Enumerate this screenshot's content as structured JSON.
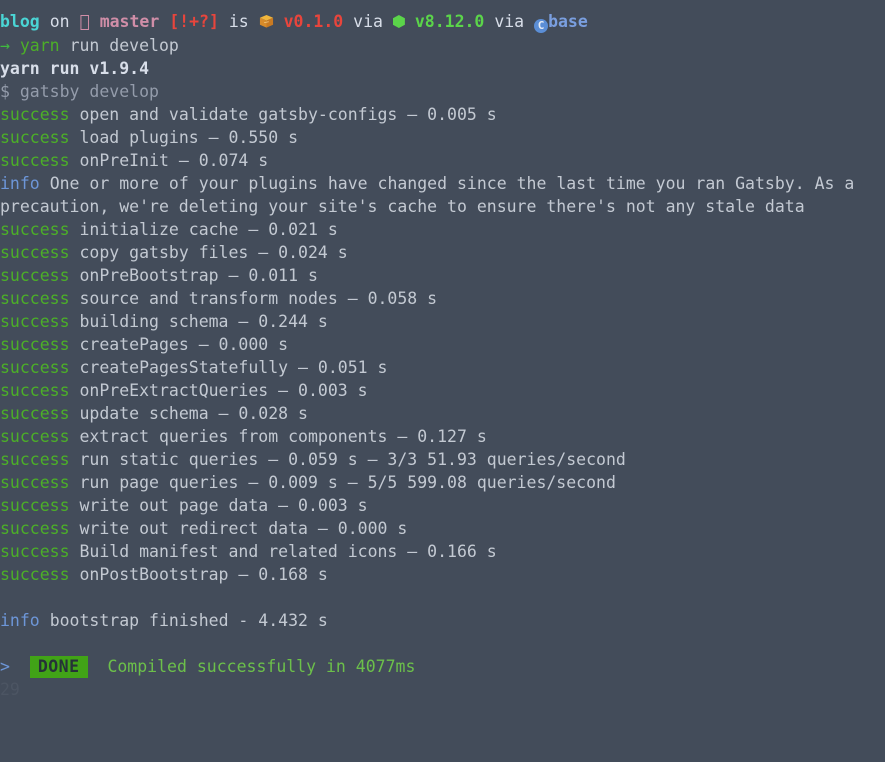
{
  "terminal": {
    "background_color": "#434c5a",
    "foreground_color": "#c9ced6",
    "prompt": {
      "dir": "blog",
      "on": "on",
      "branch_icon": "git-branch-icon",
      "branch": "master",
      "git_status": "[!+?]",
      "is": "is",
      "package_icon": "package-emoji",
      "package_version": "v0.1.0",
      "via1": "via",
      "node_icon": "node-hexagon-icon",
      "node_version": "v8.12.0",
      "via2": "via",
      "conda_icon": "conda-circle-icon",
      "conda_env": "base"
    },
    "command": {
      "arrow": "→",
      "program": "yarn",
      "args": "run develop"
    },
    "output": {
      "version_line": "yarn run v1.9.4",
      "script_line": "$ gatsby develop",
      "info_label": "info",
      "success_label": "success",
      "entries": [
        {
          "label": "success",
          "text": "open and validate gatsby-configs — 0.005 s"
        },
        {
          "label": "success",
          "text": "load plugins — 0.550 s"
        },
        {
          "label": "success",
          "text": "onPreInit — 0.074 s"
        }
      ],
      "info_message": "One or more of your plugins have changed since the last time you ran Gatsby. As a precaution, we're deleting your site's cache to ensure there's not any stale data",
      "entries2": [
        {
          "label": "success",
          "text": "initialize cache — 0.021 s"
        },
        {
          "label": "success",
          "text": "copy gatsby files — 0.024 s"
        },
        {
          "label": "success",
          "text": "onPreBootstrap — 0.011 s"
        },
        {
          "label": "success",
          "text": "source and transform nodes — 0.058 s"
        },
        {
          "label": "success",
          "text": "building schema — 0.244 s"
        },
        {
          "label": "success",
          "text": "createPages — 0.000 s"
        },
        {
          "label": "success",
          "text": "createPagesStatefully — 0.051 s"
        },
        {
          "label": "success",
          "text": "onPreExtractQueries — 0.003 s"
        },
        {
          "label": "success",
          "text": "update schema — 0.028 s"
        },
        {
          "label": "success",
          "text": "extract queries from components — 0.127 s"
        },
        {
          "label": "success",
          "text": "run static queries — 0.059 s — 3/3 51.93 queries/second"
        },
        {
          "label": "success",
          "text": "run page queries — 0.009 s — 5/5 599.08 queries/second"
        },
        {
          "label": "success",
          "text": "write out page data — 0.003 s"
        },
        {
          "label": "success",
          "text": "write out redirect data — 0.000 s"
        },
        {
          "label": "success",
          "text": "Build manifest and related icons — 0.166 s"
        },
        {
          "label": "success",
          "text": "onPostBootstrap — 0.168 s"
        }
      ],
      "bootstrap_label": "info",
      "bootstrap_text": "bootstrap finished - 4.432 s",
      "compile_chevron": ">",
      "compile_badge": "DONE",
      "compile_text": "Compiled successfully in 4077ms",
      "trailing_number": "29"
    }
  }
}
